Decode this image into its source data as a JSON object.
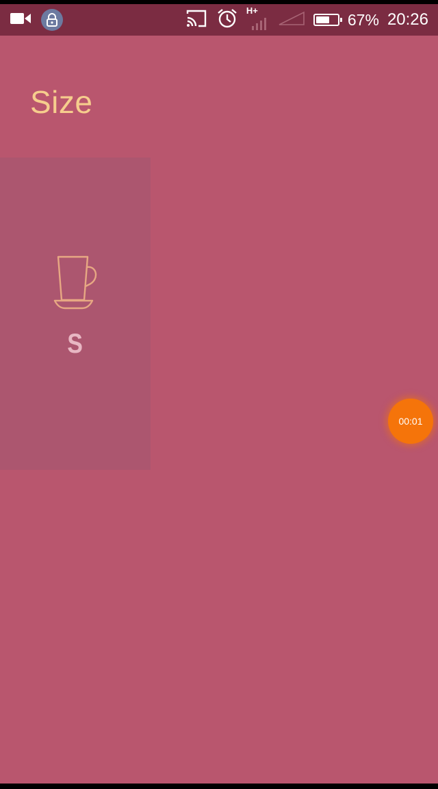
{
  "status_bar": {
    "battery_percent_text": "67%",
    "battery_level": 0.67,
    "time": "20:26",
    "network_type": "H+",
    "icons": [
      "video-camera-icon",
      "lock-icon",
      "cast-icon",
      "alarm-icon",
      "signal-icon",
      "signal-icon",
      "battery-icon"
    ]
  },
  "page": {
    "title": "Size"
  },
  "size_options": [
    {
      "label": "S",
      "icon": "cup-icon"
    }
  ],
  "timer_badge": "00:01",
  "colors": {
    "background": "#b9566e",
    "status_bar": "#7b2c42",
    "card": "#ac566f",
    "title": "#f6cd8d",
    "cup_icon": "#e7a883",
    "size_label": "#e8b7c3",
    "timer": "#f5740a"
  }
}
